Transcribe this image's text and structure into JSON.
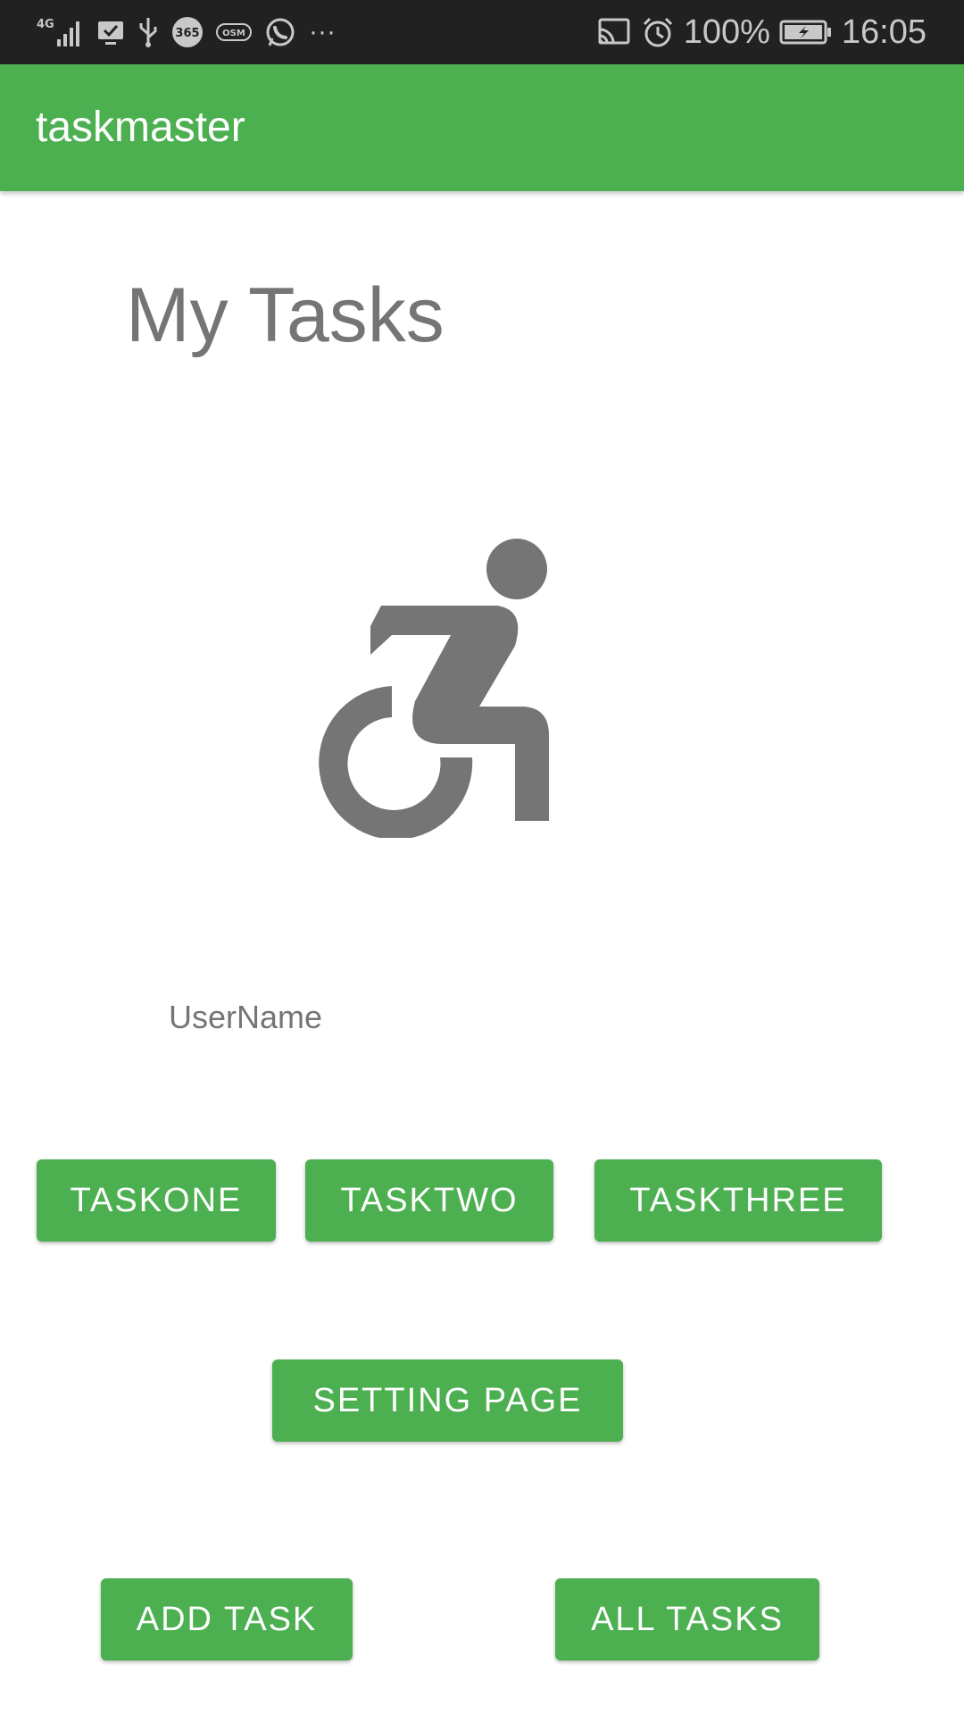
{
  "status_bar": {
    "icons_left": [
      "4g-signal-icon",
      "screen-check-icon",
      "usb-icon",
      "365-app-icon",
      "osm-app-icon",
      "whatsapp-icon",
      "more-dots-icon"
    ],
    "icons_right": [
      "cast-icon",
      "alarm-icon",
      "battery-charging-icon"
    ],
    "network_label": "4G",
    "app_365_label": "365",
    "app_osm_label": "OSM",
    "more_label": "···",
    "battery": "100%",
    "time": "16:05"
  },
  "app_bar": {
    "title": "taskmaster",
    "color": "#4caf50"
  },
  "main": {
    "title": "My Tasks",
    "hero_icon": "wheelchair-icon",
    "username": "UserName"
  },
  "buttons": {
    "task_one": "TASKONE",
    "task_two": "TASKTWO",
    "task_three": "TASKTHREE",
    "setting_page": "SETTING PAGE",
    "add_task": "ADD TASK",
    "all_tasks": "ALL TASKS"
  }
}
